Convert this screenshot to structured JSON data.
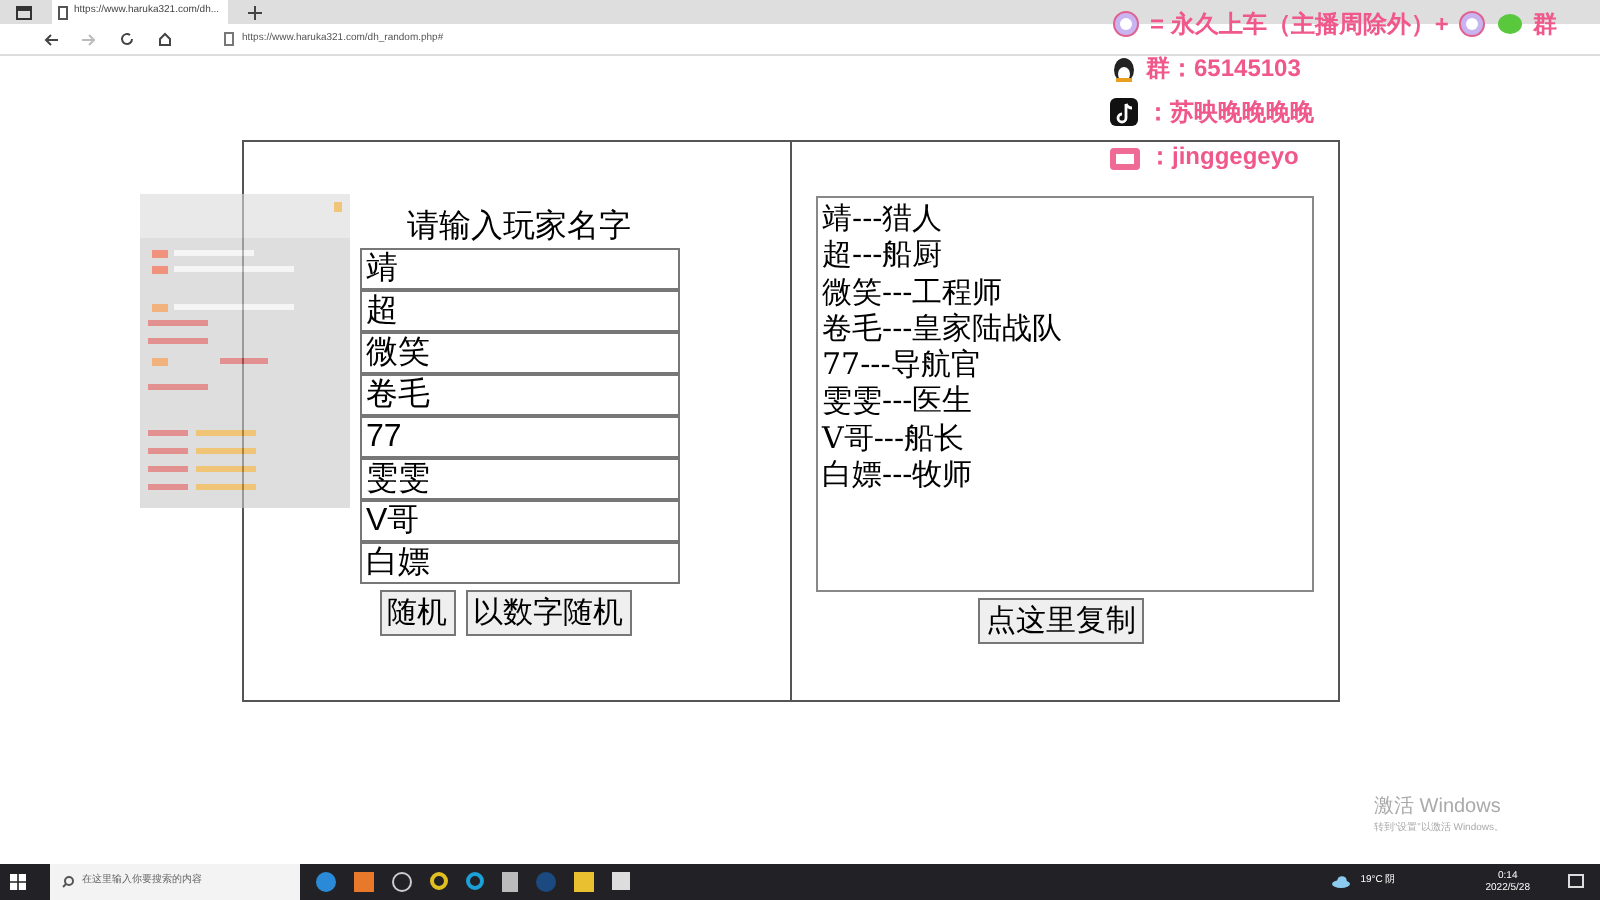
{
  "browser": {
    "tab_title": "https://www.haruka321.com/dh...",
    "url": "https://www.haruka321.com/dh_random.php#"
  },
  "left_panel": {
    "title": "请输入玩家名字",
    "players": [
      "靖",
      "超",
      "微笑",
      "卷毛",
      "77",
      "雯雯",
      "V哥",
      "白嫖"
    ],
    "buttons": [
      "随机",
      "以数字随机"
    ]
  },
  "right_panel": {
    "result_lines": [
      "靖---猎人",
      "超---船厨",
      "微笑---工程师",
      "卷毛---皇家陆战队",
      "77---导航官",
      "雯雯---医生",
      "V哥---船长",
      "白嫖---牧师"
    ],
    "copy_button": "点这里复制"
  },
  "stream_overlay": [
    {
      "kind": "star",
      "text": "= 永久上车（主播周除外）+",
      "trail": "群"
    },
    {
      "kind": "qq",
      "text": "群：65145103"
    },
    {
      "kind": "tiktok",
      "text": "：苏映晚晚晚晚"
    },
    {
      "kind": "bili",
      "text": "：jinggegeyo"
    }
  ],
  "activation_notice": {
    "title": "激活 Windows",
    "subtitle": "转到“设置”以激活 Windows。"
  },
  "taskbar": {
    "search_placeholder": "在这里输入你要搜索的内容",
    "weather": "19°C 阴",
    "time": "0:14",
    "date": "2022/5/28"
  }
}
